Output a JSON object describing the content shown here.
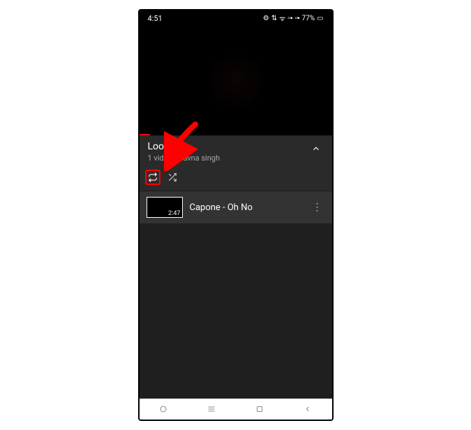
{
  "status": {
    "time": "4:51",
    "battery": "77%"
  },
  "playlist": {
    "title": "Loop",
    "subtitle": "1 video Bhavna singh"
  },
  "items": [
    {
      "duration": "2:47",
      "title": "Capone - Oh No"
    }
  ]
}
